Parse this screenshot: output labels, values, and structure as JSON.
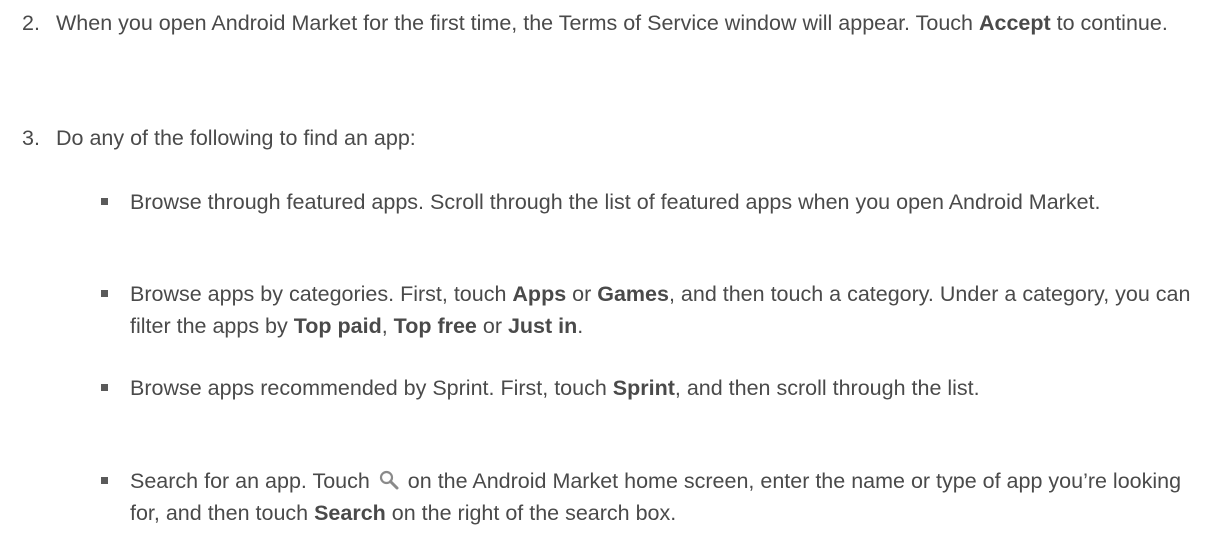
{
  "step2": {
    "number": "2.",
    "part1": "When you open Android Market for the first time, the Terms of Service window will appear. Touch ",
    "bold": "Accept",
    "part2": " to continue."
  },
  "step3": {
    "number": "3.",
    "text": "Do any of the following to find an app:"
  },
  "bullets": [
    {
      "part1": "Browse through featured apps. Scroll through the list of featured apps when you open Android Market."
    },
    {
      "part1": "Browse apps by categories. First, touch ",
      "bold1": "Apps",
      "part2": " or ",
      "bold2": "Games",
      "part3": ", and then touch a category. Under a category, you can filter the apps by ",
      "bold3": "Top paid",
      "part4": ", ",
      "bold4": "Top free",
      "part5": " or ",
      "bold5": "Just in",
      "part6": "."
    },
    {
      "part1": "Browse apps recommended by Sprint. First, touch ",
      "bold1": "Sprint",
      "part2": ", and then scroll through the list."
    },
    {
      "part1": "Search for an app. Touch ",
      "icon": "search-icon",
      "part2": " on the Android Market home screen, enter the name or type of app you’re looking for, and then touch ",
      "bold1": "Search",
      "part3": " on the right of the search box."
    }
  ]
}
